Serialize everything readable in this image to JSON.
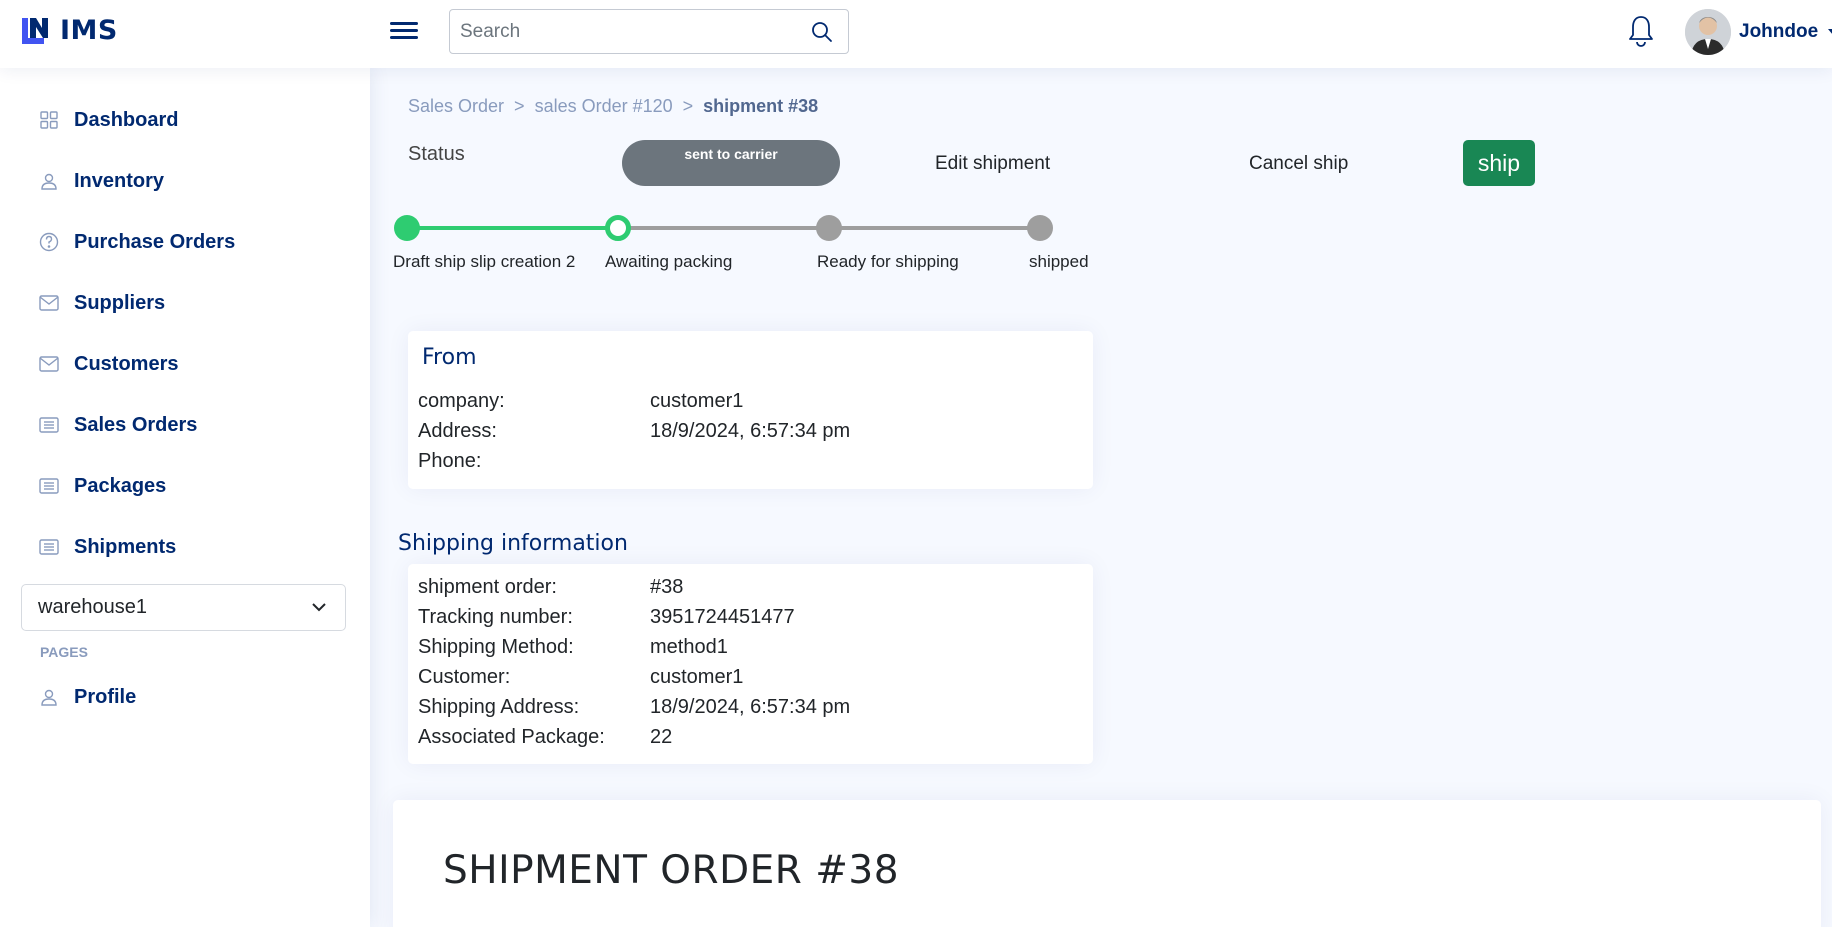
{
  "header": {
    "app_name": "IMS",
    "search_placeholder": "Search",
    "username": "Johndoe"
  },
  "sidebar": {
    "items": [
      {
        "label": "Dashboard",
        "icon": "grid-icon"
      },
      {
        "label": "Inventory",
        "icon": "person-icon"
      },
      {
        "label": "Purchase Orders",
        "icon": "question-circle-icon"
      },
      {
        "label": "Suppliers",
        "icon": "envelope-icon"
      },
      {
        "label": "Customers",
        "icon": "envelope-icon"
      },
      {
        "label": "Sales Orders",
        "icon": "list-icon"
      },
      {
        "label": "Packages",
        "icon": "list-icon"
      },
      {
        "label": "Shipments",
        "icon": "list-icon"
      }
    ],
    "warehouse_selected": "warehouse1",
    "pages_heading": "PAGES",
    "profile_label": "Profile"
  },
  "breadcrumb": {
    "items": [
      "Sales Order",
      "sales Order #120",
      "shipment #38"
    ],
    "separator": ">"
  },
  "status": {
    "label": "Status",
    "pill": "sent to carrier",
    "edit_label": "Edit shipment",
    "cancel_label": "Cancel ship",
    "ship_label": "ship"
  },
  "stepper": {
    "steps": [
      {
        "label": "Draft ship slip creation 2",
        "state": "done"
      },
      {
        "label": "Awaiting packing",
        "state": "current"
      },
      {
        "label": "Ready for shipping",
        "state": "pending"
      },
      {
        "label": "shipped",
        "state": "pending"
      }
    ],
    "done_color": "#2ecc71",
    "pending_color": "#9e9e9e"
  },
  "from": {
    "title": "From",
    "rows": [
      {
        "key": "company:",
        "value": "customer1"
      },
      {
        "key": "Address:",
        "value": "18/9/2024, 6:57:34 pm"
      },
      {
        "key": "Phone:",
        "value": ""
      }
    ]
  },
  "shipping": {
    "title": "Shipping information",
    "rows": [
      {
        "key": "shipment order:",
        "value": "#38"
      },
      {
        "key": "Tracking number:",
        "value": "3951724451477"
      },
      {
        "key": "Shipping Method:",
        "value": "method1"
      },
      {
        "key": "Customer:",
        "value": "customer1"
      },
      {
        "key": "Shipping Address:",
        "value": "18/9/2024, 6:57:34 pm"
      },
      {
        "key": "Associated Package:",
        "value": "22"
      }
    ]
  },
  "order_card": {
    "title": "SHIPMENT ORDER #38"
  },
  "colors": {
    "brand": "#012970",
    "ship_button": "#198754",
    "status_pill": "#6c757d"
  }
}
